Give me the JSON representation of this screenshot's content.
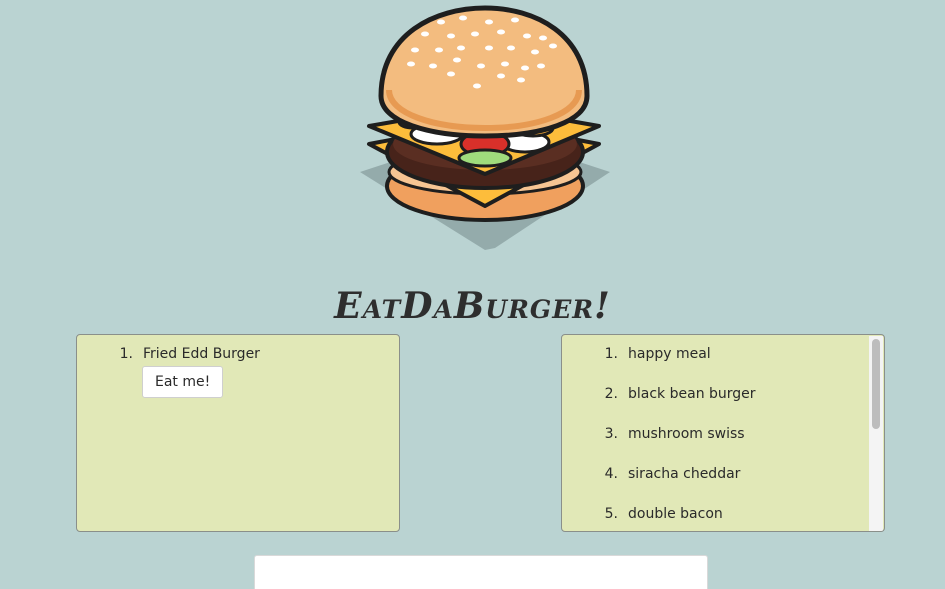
{
  "app": {
    "title": "EatDaBurger!",
    "logo_icon": "hamburger-icon"
  },
  "devoured_panel": {
    "items": [
      {
        "number": "1.",
        "name": "Fried Edd Burger",
        "button_label": "Eat me!"
      }
    ]
  },
  "eaten_panel": {
    "items": [
      {
        "number": "1.",
        "name": "happy meal"
      },
      {
        "number": "2.",
        "name": "black bean burger"
      },
      {
        "number": "3.",
        "name": "mushroom swiss"
      },
      {
        "number": "4.",
        "name": "siracha cheddar"
      },
      {
        "number": "5.",
        "name": "double bacon"
      }
    ]
  },
  "colors": {
    "background": "#bad3d2",
    "panel": "#e1e8b7"
  }
}
